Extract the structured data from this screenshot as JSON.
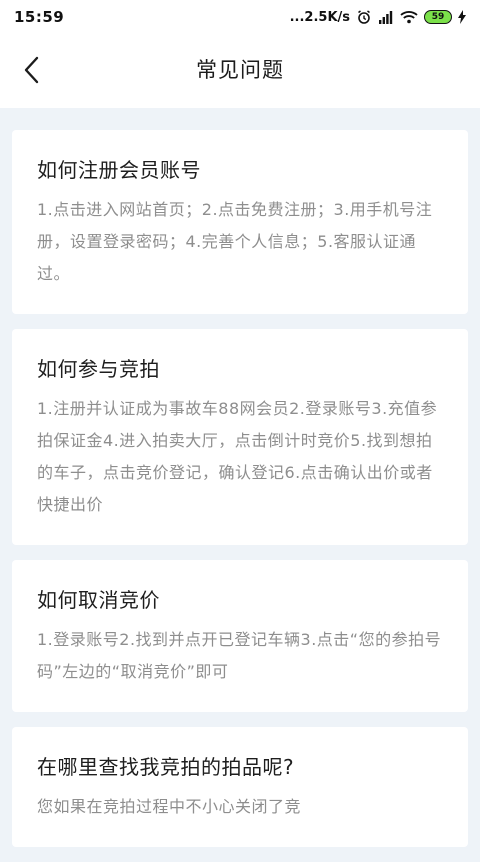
{
  "status_bar": {
    "time": "15:59",
    "network_speed": "...2.5K/s",
    "battery_level": "59"
  },
  "nav": {
    "title": "常见问题"
  },
  "faq": [
    {
      "question": "如何注册会员账号",
      "answer": "1.点击进入网站首页；2.点击免费注册；3.用手机号注册，设置登录密码；4.完善个人信息；5.客服认证通过。"
    },
    {
      "question": "如何参与竞拍",
      "answer": "1.注册并认证成为事故车88网会员2.登录账号3.充值参拍保证金4.进入拍卖大厅，点击倒计时竞价5.找到想拍的车子，点击竞价登记，确认登记6.点击确认出价或者快捷出价"
    },
    {
      "question": "如何取消竞价",
      "answer": "1.登录账号2.找到并点开已登记车辆3.点击“您的参拍号码”左边的“取消竞价”即可"
    },
    {
      "question": "在哪里查找我竞拍的拍品呢?",
      "answer": "您如果在竞拍过程中不小心关闭了竞"
    }
  ]
}
